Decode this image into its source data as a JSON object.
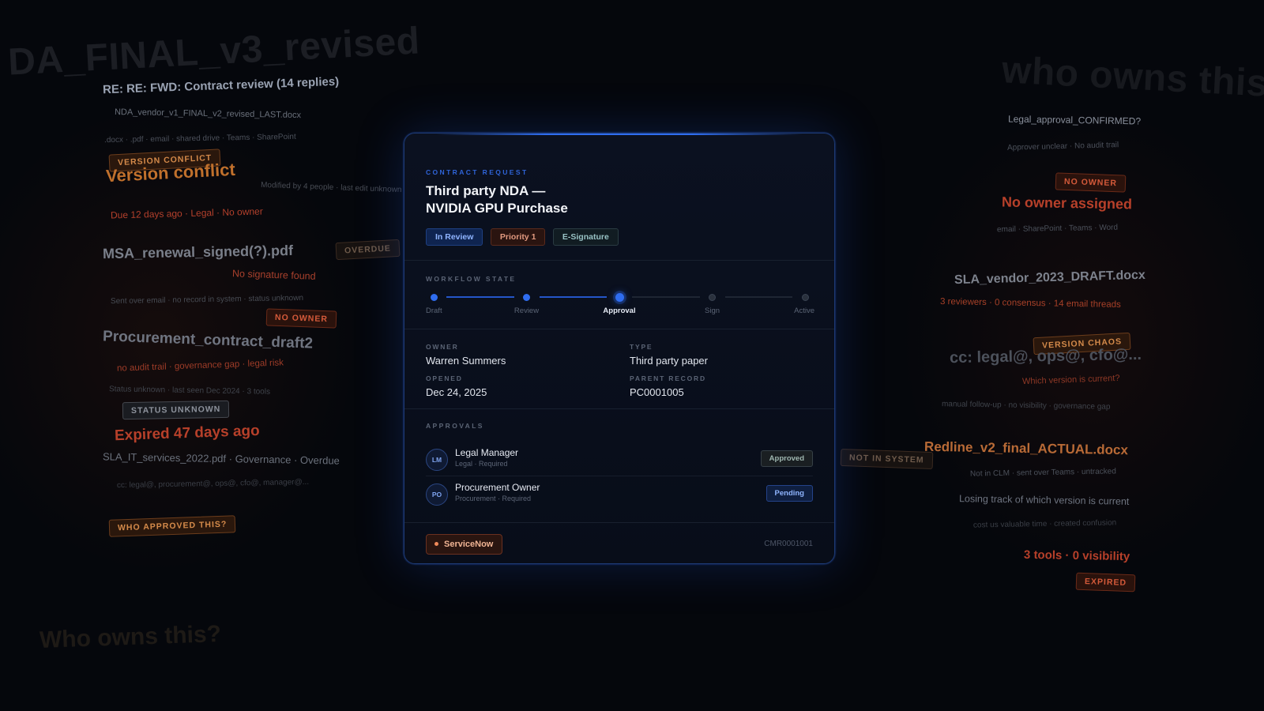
{
  "background": {
    "ghost_title_left": "DA_FINAL_v3_revised",
    "ghost_title_right": "who owns this",
    "ghost_bottom_left": "Who owns this?",
    "left": {
      "email_subject": "RE: RE: FWD: Contract review (14 replies)",
      "file_1": "NDA_vendor_v1_FINAL_v2_revised_LAST.docx",
      "channels": ".docx · .pdf · email · shared drive · Teams · SharePoint",
      "tag_version_conflict": "VERSION CONFLICT",
      "heading_version_conflict": "Version conflict",
      "modified_by": "Modified by 4 people · last edit unknown",
      "due_line": "Due 12 days ago · Legal · No owner",
      "file_msa": "MSA_renewal_signed(?).pdf",
      "tag_overdue": "OVERDUE",
      "no_signature": "No signature found",
      "sent_over_email": "Sent over email · no record in system · status unknown",
      "tag_no_owner": "NO OWNER",
      "file_procurement": "Procurement_contract_draft2",
      "audit_line": "no audit trail · governance gap · legal risk",
      "status_unknown_line": "Status unknown · last seen Dec 2024 · 3 tools",
      "tag_status_unknown": "STATUS UNKNOWN",
      "expired_heading": "Expired 47 days ago",
      "sla_it": "SLA_IT_services_2022.pdf · Governance · Overdue",
      "cc_line": "cc: legal@, procurement@, ops@, cfo@, manager@...",
      "tag_who_approved": "WHO APPROVED THIS?"
    },
    "right": {
      "legal_approval": "Legal_approval_CONFIRMED?",
      "approver_unclear": "Approver unclear · No audit trail",
      "tag_no_owner": "NO OWNER",
      "no_owner_assigned": "No owner assigned",
      "channels": "email · SharePoint · Teams · Word",
      "file_sla_vendor": "SLA_vendor_2023_DRAFT.docx",
      "reviewers": "3 reviewers · 0 consensus · 14 email threads",
      "tag_version_chaos": "VERSION CHAOS",
      "cc_heading": "cc: legal@, ops@, cfo@...",
      "which_version": "Which version is current?",
      "manual_followup": "manual follow-up · no visibility · governance gap",
      "tag_not_in_system": "NOT IN SYSTEM",
      "file_redline": "Redline_v2_final_ACTUAL.docx",
      "not_in_clm": "Not in CLM · sent over Teams · untracked",
      "losing_track": "Losing track of which version is current",
      "cost_us": "cost us valuable time · created confusion",
      "tools_visibility": "3 tools · 0 visibility",
      "tag_expired": "EXPIRED"
    }
  },
  "card": {
    "eyebrow": "CONTRACT REQUEST",
    "title_line1": "Third party NDA —",
    "title_line2": "NVIDIA GPU Purchase",
    "pills": [
      "In Review",
      "Priority 1",
      "E-Signature"
    ],
    "workflow_label": "WORKFLOW STATE",
    "steps": [
      "Draft",
      "Review",
      "Approval",
      "Sign",
      "Active"
    ],
    "current_step_index": 2,
    "fields": {
      "owner_label": "OWNER",
      "owner_value": "Warren Summers",
      "type_label": "TYPE",
      "type_value": "Third party paper",
      "opened_label": "OPENED",
      "opened_value": "Dec 24, 2025",
      "parent_label": "PARENT RECORD",
      "parent_value": "PC0001005"
    },
    "approvals_label": "APPROVALS",
    "approvals": [
      {
        "initials": "LM",
        "name": "Legal Manager",
        "sub": "Legal · Required",
        "status": "Approved"
      },
      {
        "initials": "PO",
        "name": "Procurement Owner",
        "sub": "Procurement · Required",
        "status": "Pending"
      }
    ],
    "footer_source": "ServiceNow",
    "footer_id": "CMR0001001"
  },
  "colors": {
    "accent_blue": "#2f6df0",
    "warning_red": "#b7402a",
    "warning_orange": "#c0702c",
    "background": "#05070c"
  }
}
